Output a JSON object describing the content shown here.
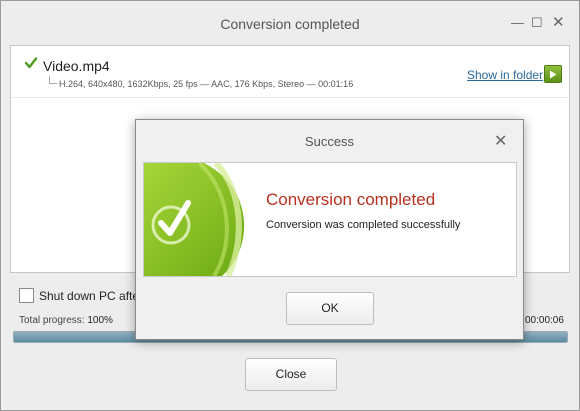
{
  "window": {
    "title": "Conversion completed",
    "minimize_glyph": "—",
    "maximize_glyph": "☐",
    "close_glyph": "✕"
  },
  "file": {
    "name": "Video.mp4",
    "details": "H.264, 640x480, 1632Kbps, 25 fps — AAC, 176 Kbps, Stereo — 00:01:16",
    "show_in_folder": "Show in folder",
    "status_icon": "check-icon",
    "play_icon": "play-icon"
  },
  "options": {
    "shutdown_label": "Shut down PC after",
    "shutdown_checked": false
  },
  "progress": {
    "label": "Total progress:",
    "value": "100%",
    "fraction": 1.0,
    "time": "00:00:06"
  },
  "buttons": {
    "close": "Close",
    "ok": "OK"
  },
  "dialog": {
    "title": "Success",
    "close_glyph": "✕",
    "heading": "Conversion completed",
    "message": "Conversion was completed successfully"
  },
  "colors": {
    "heading_red": "#b8321f",
    "accent_green": "#7cb518",
    "link_blue": "#2a6a9e",
    "progress_fill": "#5f8aa1"
  }
}
